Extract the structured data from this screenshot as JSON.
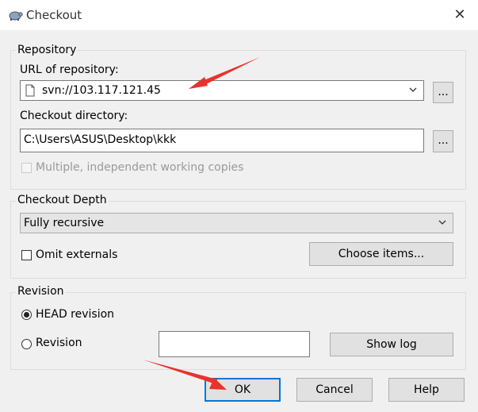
{
  "window": {
    "title": "Checkout",
    "close_symbol": "✕"
  },
  "repository": {
    "legend": "Repository",
    "url_label": "URL of repository:",
    "url_value": "svn://103.117.121.45",
    "browse_label": "...",
    "dir_label": "Checkout directory:",
    "dir_value": "C:\\Users\\ASUS\\Desktop\\kkk",
    "dir_browse_label": "...",
    "multiple_label": "Multiple, independent working copies"
  },
  "depth": {
    "legend": "Checkout Depth",
    "selected": "Fully recursive",
    "omit_label": "Omit externals",
    "choose_label": "Choose items..."
  },
  "revision": {
    "legend": "Revision",
    "head_label": "HEAD revision",
    "revision_label": "Revision",
    "revision_value": "",
    "showlog_label": "Show log"
  },
  "buttons": {
    "ok": "OK",
    "cancel": "Cancel",
    "help": "Help"
  },
  "colors": {
    "annotation_arrow": "#e8322e",
    "title_bar": "#ffffff",
    "dialog_bg": "#f0f0f0"
  }
}
